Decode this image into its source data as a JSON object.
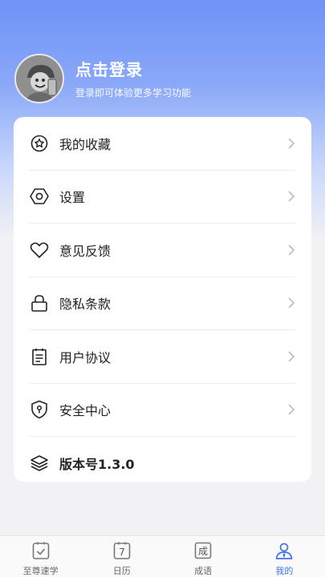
{
  "profile": {
    "title": "点击登录",
    "subtitle": "登录即可体验更多学习功能"
  },
  "menu": {
    "items": [
      {
        "label": "我的收藏",
        "icon": "favorite-star-icon"
      },
      {
        "label": "设置",
        "icon": "settings-hexagon-icon"
      },
      {
        "label": "意见反馈",
        "icon": "heart-icon"
      },
      {
        "label": "隐私条款",
        "icon": "lock-icon"
      },
      {
        "label": "用户协议",
        "icon": "document-icon"
      },
      {
        "label": "安全中心",
        "icon": "shield-icon"
      },
      {
        "label": "版本号1.3.0",
        "icon": "layers-icon"
      }
    ]
  },
  "tabs": [
    {
      "label": "至尊速学",
      "icon": "check-square-icon",
      "active": false
    },
    {
      "label": "日历",
      "icon": "calendar-icon",
      "glyph": "7",
      "active": false
    },
    {
      "label": "成语",
      "icon": "idiom-icon",
      "glyph": "成",
      "active": false
    },
    {
      "label": "我的",
      "icon": "user-profile-icon",
      "active": true
    }
  ],
  "colors": {
    "accent": "#3f74f0",
    "header_top": "#6f93f7",
    "background": "#f2f2f4"
  }
}
